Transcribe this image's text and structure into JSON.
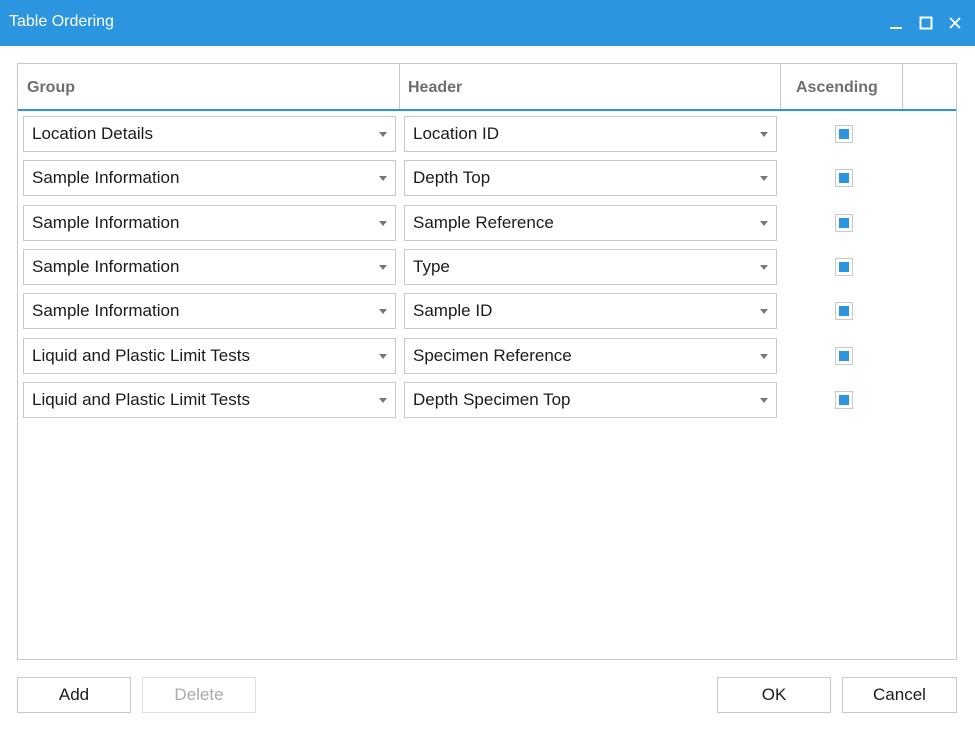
{
  "window": {
    "title": "Table Ordering",
    "controls": [
      "minimize-icon",
      "maximize-icon",
      "close-icon"
    ],
    "accent_color": "#2b96df"
  },
  "grid": {
    "columns": {
      "group": "Group",
      "header": "Header",
      "ascending": "Ascending"
    },
    "rows": [
      {
        "group": "Location Details",
        "header": "Location ID",
        "ascending": true
      },
      {
        "group": "Sample Information",
        "header": "Depth Top",
        "ascending": true
      },
      {
        "group": "Sample Information",
        "header": "Sample Reference",
        "ascending": true
      },
      {
        "group": "Sample Information",
        "header": "Type",
        "ascending": true
      },
      {
        "group": "Sample Information",
        "header": "Sample ID",
        "ascending": true
      },
      {
        "group": "Liquid and Plastic Limit Tests",
        "header": "Specimen Reference",
        "ascending": true
      },
      {
        "group": "Liquid and Plastic Limit Tests",
        "header": "Depth Specimen Top",
        "ascending": true
      }
    ]
  },
  "buttons": {
    "add": "Add",
    "delete": "Delete",
    "ok": "OK",
    "cancel": "Cancel"
  }
}
